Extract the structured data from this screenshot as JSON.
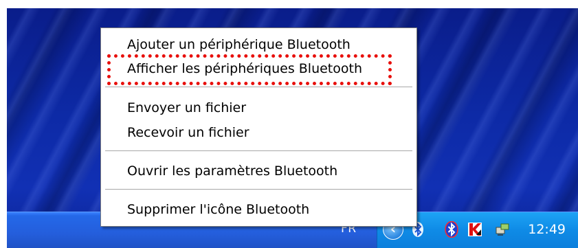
{
  "menu": {
    "items": [
      {
        "label": "Ajouter un périphérique Bluetooth"
      },
      {
        "label": "Afficher les périphériques Bluetooth"
      },
      {
        "label": "Envoyer un fichier"
      },
      {
        "label": "Recevoir un fichier"
      },
      {
        "label": "Ouvrir les paramètres Bluetooth"
      },
      {
        "label": "Supprimer l'icône Bluetooth"
      }
    ]
  },
  "taskbar": {
    "language": "FR",
    "clock": "12:49",
    "tray_icons": [
      "show-hidden-icons-icon",
      "bluetooth-icon",
      "bluetooth-icon",
      "antivirus-icon",
      "network-icon"
    ]
  },
  "colors": {
    "highlight": "#e8100c",
    "taskbar": "#245edc",
    "tray": "#0f8be6"
  }
}
